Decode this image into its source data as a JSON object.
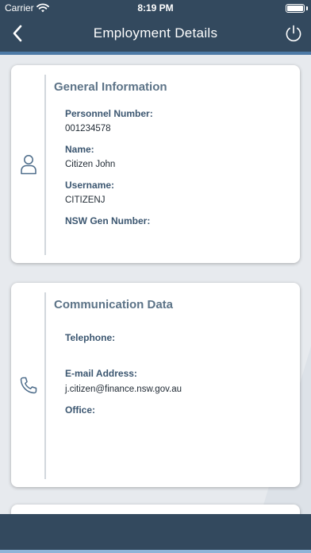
{
  "status_bar": {
    "carrier": "Carrier",
    "time": "8:19 PM"
  },
  "nav": {
    "title": "Employment Details",
    "back_icon": "chevron-left-icon",
    "power_icon": "power-icon"
  },
  "colors": {
    "nav_background": "#33495e",
    "accent": "#4d7aa6",
    "section_title": "#5c7387",
    "field_label": "#3b5670"
  },
  "general_information": {
    "title": "General Information",
    "icon": "person-icon",
    "fields": [
      {
        "label": "Personnel Number:",
        "value": "001234578"
      },
      {
        "label": "Name:",
        "value": "Citizen John"
      },
      {
        "label": "Username:",
        "value": "CITIZENJ"
      },
      {
        "label": "NSW Gen Number:",
        "value": ""
      }
    ]
  },
  "communication_data": {
    "title": "Communication Data",
    "icon": "phone-icon",
    "fields": [
      {
        "label": "Telephone:",
        "value": ""
      },
      {
        "label": "E-mail Address:",
        "value": "j.citizen@finance.nsw.gov.au"
      },
      {
        "label": "Office:",
        "value": ""
      }
    ]
  }
}
